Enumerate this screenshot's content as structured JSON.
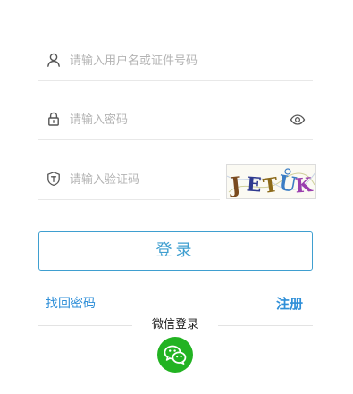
{
  "form": {
    "username": {
      "placeholder": "请输入用户名或证件号码",
      "value": ""
    },
    "password": {
      "placeholder": "请输入密码",
      "value": ""
    },
    "captcha_input": {
      "placeholder": "请输入验证码",
      "value": ""
    },
    "captcha_image_text": "JETUK"
  },
  "actions": {
    "login_label": "登录",
    "forgot_password_label": "找回密码",
    "register_label": "注册"
  },
  "third_party": {
    "title": "微信登录",
    "icon": "wechat-icon"
  },
  "icons": {
    "username": "user-icon",
    "password": "lock-icon",
    "password_toggle": "eye-icon",
    "captcha": "shield-icon"
  },
  "colors": {
    "accent": "#3f9fd0",
    "link": "#2f8fd8",
    "wechat": "#22b322",
    "divider": "#e3e3e3",
    "placeholder": "#b4b4b4"
  }
}
